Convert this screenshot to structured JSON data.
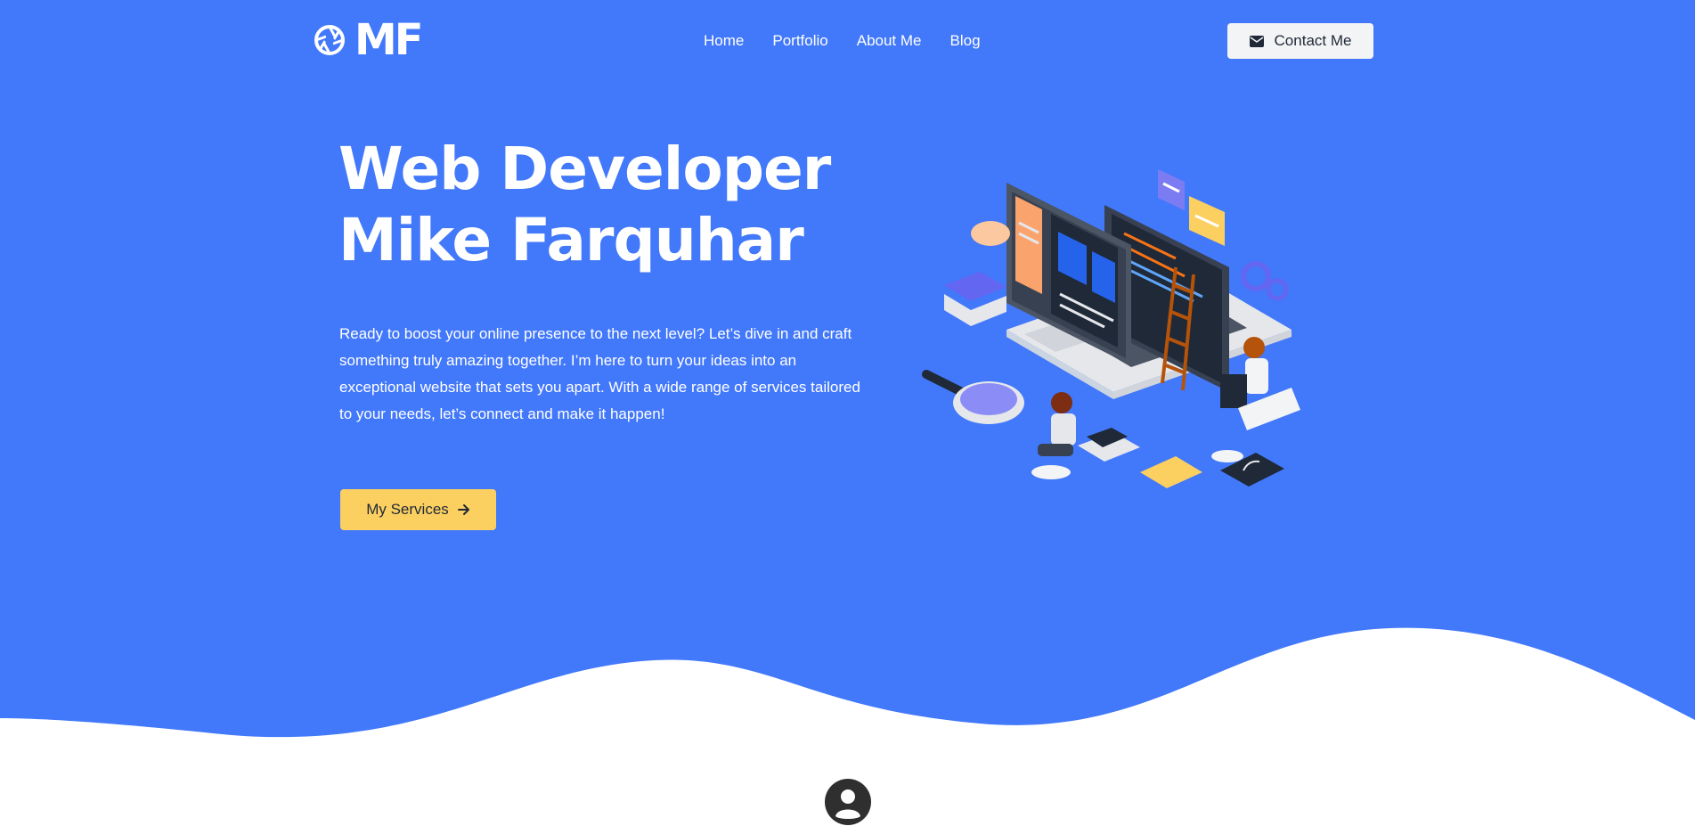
{
  "colors": {
    "hero_bg": "#4278fa",
    "button_yellow": "#fcd060",
    "contact_bg": "#f3f4f6",
    "text_dark": "#1f2937",
    "white": "#ffffff"
  },
  "logo": {
    "text": "MF",
    "mark_icon": "aperture-icon"
  },
  "nav": {
    "items": [
      {
        "label": "Home"
      },
      {
        "label": "Portfolio"
      },
      {
        "label": "About Me"
      },
      {
        "label": "Blog"
      }
    ]
  },
  "header": {
    "contact_label": "Contact Me",
    "contact_icon": "envelope-icon"
  },
  "hero": {
    "title_line1": "Web Developer",
    "title_line2": "Mike Farquhar",
    "description": "Ready to boost your online presence to the next level? Let’s dive in and craft something truly amazing together. I’m here to turn your ideas into an exceptional website that sets you apart. With a wide range of services tailored to your needs, let’s connect and make it happen!",
    "button_label": "My Services",
    "button_icon": "arrow-right-icon",
    "illustration": "web-developer-isometric-illustration"
  },
  "section": {
    "icon": "user-circle-icon"
  }
}
